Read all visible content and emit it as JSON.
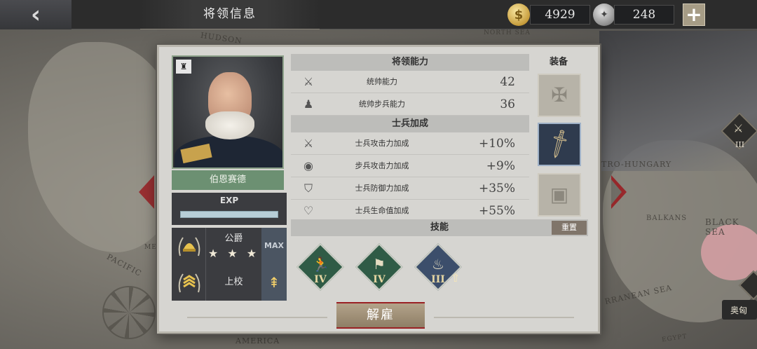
{
  "topbar": {
    "back_icon": "back-arrow-icon",
    "title": "将领信息",
    "gold": "4929",
    "silver": "248",
    "add_icon": "plus-icon"
  },
  "map": {
    "labels": [
      "HUDSON",
      "NORTH SEA",
      "TRO-HUNGARY",
      "BALKANS",
      "BLACK SEA",
      "RRANEAN SEA",
      "PACIFIC",
      "AMERICA",
      "EGYPT",
      "ME"
    ],
    "side_badge_level": "III",
    "side_chip": "奥匈"
  },
  "general": {
    "name": "伯恩赛德",
    "exp_label": "EXP",
    "exp_fraction": 0,
    "title_rank": "公爵",
    "title_stars": "★ ★ ★",
    "max_label": "MAX",
    "military_rank": "上校",
    "upgrade_icon": "upgrade-arrow-icon"
  },
  "abilities": {
    "heading": "将领能力",
    "rows": [
      {
        "icon": "crossed-swords-icon",
        "label": "统帅能力",
        "value": "42"
      },
      {
        "icon": "infantry-helmet-icon",
        "label": "统帅步兵能力",
        "value": "36"
      }
    ]
  },
  "bonuses": {
    "heading": "士兵加成",
    "rows": [
      {
        "icon": "attack-up-icon",
        "label": "士兵攻击力加成",
        "value": "+10%"
      },
      {
        "icon": "infantry-attack-icon",
        "label": "步兵攻击力加成",
        "value": "+9%"
      },
      {
        "icon": "shield-up-icon",
        "label": "士兵防御力加成",
        "value": "+35%"
      },
      {
        "icon": "heart-up-icon",
        "label": "士兵生命值加成",
        "value": "+55%"
      }
    ]
  },
  "equipment": {
    "heading": "装备",
    "slots": [
      "medal-slot-icon",
      "sword-icon",
      "chest-slot-icon"
    ]
  },
  "skills": {
    "heading": "技能",
    "reset_label": "重置",
    "items": [
      {
        "icon": "running-soldier-icon",
        "level": "IV",
        "color": "#2f5b46"
      },
      {
        "icon": "prone-rifleman-icon",
        "level": "IV",
        "color": "#2f5b46"
      },
      {
        "icon": "flame-soldier-icon",
        "level": "III",
        "color": "#3c4e6b"
      }
    ]
  },
  "actions": {
    "dismiss_label": "解雇"
  }
}
